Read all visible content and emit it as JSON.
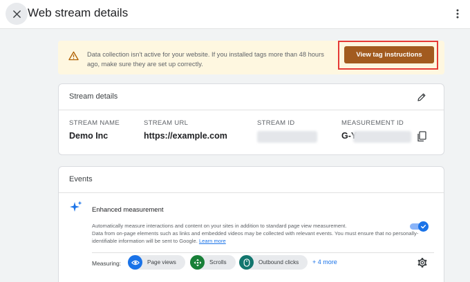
{
  "header": {
    "title": "Web stream details"
  },
  "banner": {
    "message": "Data collection isn't active for your website. If you installed tags more than 48 hours ago, make sure they are set up correctly.",
    "button_label": "View tag instructions"
  },
  "stream_details": {
    "title": "Stream details",
    "columns": [
      {
        "label": "STREAM NAME",
        "value": "Demo Inc"
      },
      {
        "label": "STREAM URL",
        "value": "https://example.com"
      },
      {
        "label": "STREAM ID",
        "value": ""
      },
      {
        "label": "MEASUREMENT ID",
        "value": "G-Y"
      }
    ]
  },
  "events": {
    "title": "Events",
    "enhanced": {
      "title": "Enhanced measurement",
      "description": "Automatically measure interactions and content on your sites in addition to standard page view measurement.",
      "note": "Data from on-page elements such as links and embedded videos may be collected with relevant events. You must ensure that no personally-identifiable information will be sent to Google.",
      "learn_more": "Learn more",
      "enabled": true
    },
    "measuring_label": "Measuring:",
    "chips": [
      {
        "label": "Page views",
        "icon": "eye-icon",
        "color": "#1a73e8"
      },
      {
        "label": "Scrolls",
        "icon": "crosshair-icon",
        "color": "#188038"
      },
      {
        "label": "Outbound clicks",
        "icon": "mouse-icon",
        "color": "#12766e"
      }
    ],
    "more_label": "+ 4 more"
  },
  "colors": {
    "primary": "#1a73e8",
    "banner_bg": "#fef7e0",
    "button_brown": "#a25b1f",
    "highlight_red": "#e53935"
  }
}
